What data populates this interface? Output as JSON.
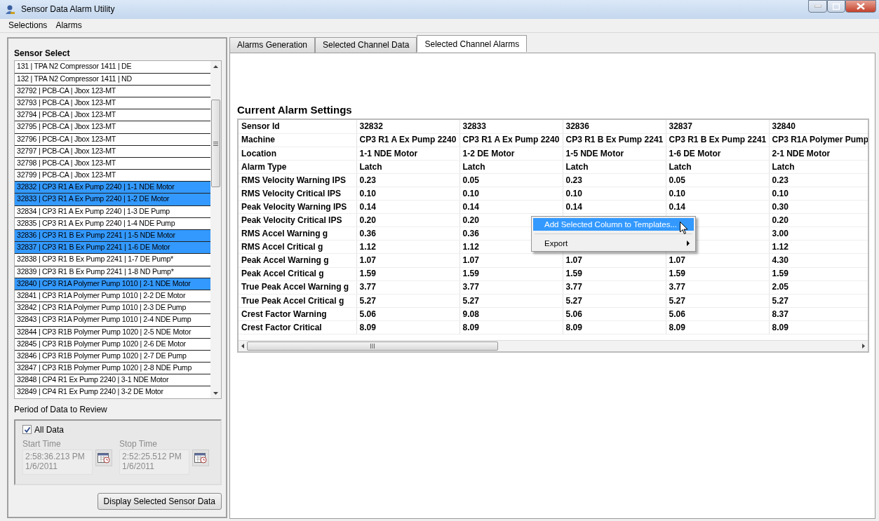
{
  "window": {
    "title": "Sensor Data Alarm Utility"
  },
  "menu": [
    "Selections",
    "Alarms"
  ],
  "sensor_select": {
    "title": "Sensor Select",
    "items": [
      {
        "label": "131 | TPA N2 Compressor 1411 | DE",
        "selected": false
      },
      {
        "label": "132 | TPA N2 Compressor 1411 | ND",
        "selected": false
      },
      {
        "label": "32792 | PCB-CA | Jbox 123-MT",
        "selected": false
      },
      {
        "label": "32793 | PCB-CA | Jbox 123-MT",
        "selected": false
      },
      {
        "label": "32794 | PCB-CA | Jbox 123-MT",
        "selected": false
      },
      {
        "label": "32795 | PCB-CA | Jbox 123-MT",
        "selected": false
      },
      {
        "label": "32796 | PCB-CA | Jbox 123-MT",
        "selected": false
      },
      {
        "label": "32797 | PCB-CA | Jbox 123-MT",
        "selected": false
      },
      {
        "label": "32798 | PCB-CA | Jbox 123-MT",
        "selected": false
      },
      {
        "label": "32799 | PCB-CA | Jbox 123-MT",
        "selected": false
      },
      {
        "label": "32832 | CP3 R1 A Ex Pump 2240 | 1-1 NDE Motor",
        "selected": true
      },
      {
        "label": "32833 | CP3 R1 A Ex Pump 2240 | 1-2 DE Motor",
        "selected": true
      },
      {
        "label": "32834 | CP3 R1 A Ex Pump 2240 | 1-3 DE Pump",
        "selected": false
      },
      {
        "label": "32835 | CP3 R1 A Ex Pump 2240 | 1-4 NDE Pump",
        "selected": false
      },
      {
        "label": "32836 | CP3 R1 B Ex Pump 2241 | 1-5 NDE Motor",
        "selected": true
      },
      {
        "label": "32837 | CP3 R1 B Ex Pump 2241 | 1-6 DE Motor",
        "selected": true
      },
      {
        "label": "32838 | CP3 R1 B Ex Pump 2241 | 1-7 DE Pump*",
        "selected": false
      },
      {
        "label": "32839 | CP3 R1 B Ex Pump 2241 | 1-8 ND Pump*",
        "selected": false
      },
      {
        "label": "32840 | CP3 R1A Polymer Pump 1010 | 2-1 NDE Motor",
        "selected": true
      },
      {
        "label": "32841 | CP3 R1A Polymer Pump 1010 | 2-2 DE Motor",
        "selected": false
      },
      {
        "label": "32842 | CP3 R1A Polymer Pump 1010 | 2-3 DE Pump",
        "selected": false
      },
      {
        "label": "32843 | CP3 R1A Polymer Pump 1010 | 2-4 NDE Pump",
        "selected": false
      },
      {
        "label": "32844 | CP3 R1B Polymer Pump 1020 | 2-5 NDE Motor",
        "selected": false
      },
      {
        "label": "32845 | CP3 R1B Polymer Pump 1020 | 2-6 DE Motor",
        "selected": false
      },
      {
        "label": "32846 | CP3 R1B Polymer Pump 1020 | 2-7 DE Pump",
        "selected": false
      },
      {
        "label": "32847 | CP3 R1B Polymer Pump 1020 | 2-8 NDE Pump",
        "selected": false
      },
      {
        "label": "32848 | CP4 R1 Ex Pump 2240 | 3-1 NDE Motor",
        "selected": false
      },
      {
        "label": "32849 | CP4 R1 Ex Pump 2240 | 3-2 DE Motor",
        "selected": false
      }
    ]
  },
  "period": {
    "title": "Period of Data to Review",
    "all_data": {
      "label": "All Data",
      "checked": true
    },
    "fields": [
      {
        "label": "Start Time",
        "lines": [
          "2:58:36.213 PM",
          "1/6/2011"
        ],
        "disabled": true
      },
      {
        "label": "Stop Time",
        "lines": [
          "2:52:25.512 PM",
          "1/6/2011"
        ],
        "disabled": true
      }
    ]
  },
  "display_button": "Display Selected Sensor Data",
  "tabs": [
    {
      "label": "Alarms Generation",
      "selected": false
    },
    {
      "label": "Selected Channel Data",
      "selected": false
    },
    {
      "label": "Selected Channel Alarms",
      "selected": true
    }
  ],
  "alarm_settings": {
    "title": "Current Alarm Settings",
    "row_labels": [
      "Sensor Id",
      "Machine",
      "Location",
      "Alarm Type",
      "RMS Velocity Warning IPS",
      "RMS Velocity Critical IPS",
      "Peak Velocity Warning IPS",
      "Peak Velocity Critical IPS",
      "RMS Accel Warning g",
      "RMS Accel Critical g",
      "Peak Accel Warning g",
      "Peak Accel Critical g",
      "True Peak Accel Warning g",
      "True Peak Accel Critical g",
      "Crest Factor Warning",
      "Crest Factor Critical"
    ],
    "columns": [
      {
        "cells": [
          "32832",
          "CP3 R1 A Ex Pump 2240",
          "1-1 NDE Motor",
          "Latch",
          "0.23",
          "0.10",
          "0.14",
          "0.20",
          "0.36",
          "1.12",
          "1.07",
          "1.59",
          "3.77",
          "5.27",
          "5.06",
          "8.09"
        ]
      },
      {
        "cells": [
          "32833",
          "CP3 R1 A Ex Pump 2240",
          "1-2 DE Motor",
          "Latch",
          "0.05",
          "0.10",
          "0.14",
          "0.20",
          "0.36",
          "1.12",
          "1.07",
          "1.59",
          "3.77",
          "5.27",
          "9.08",
          "8.09"
        ]
      },
      {
        "cells": [
          "32836",
          "CP3 R1 B Ex Pump 2241",
          "1-5 NDE Motor",
          "Latch",
          "0.23",
          "0.10",
          "0.14",
          null,
          null,
          null,
          "1.07",
          "1.59",
          "3.77",
          "5.27",
          "5.06",
          "8.09"
        ]
      },
      {
        "cells": [
          "32837",
          "CP3 R1 B Ex Pump 2241",
          "1-6 DE Motor",
          "Latch",
          "0.05",
          "0.10",
          "0.14",
          null,
          null,
          null,
          "1.07",
          "1.59",
          "3.77",
          "5.27",
          "5.06",
          "8.09"
        ]
      },
      {
        "cells": [
          "32840",
          "CP3 R1A Polymer Pump",
          "2-1 NDE Motor",
          "Latch",
          "0.23",
          "0.10",
          "0.30",
          "0.20",
          "3.00",
          "1.12",
          "4.30",
          "1.59",
          "2.05",
          "5.27",
          "8.37",
          "8.09"
        ]
      }
    ]
  },
  "context_menu": {
    "items": [
      {
        "kind": "action",
        "label": "Add Selected Column to Templates...",
        "selected": true
      },
      {
        "kind": "submenu",
        "label": "Export",
        "selected": false
      }
    ]
  }
}
